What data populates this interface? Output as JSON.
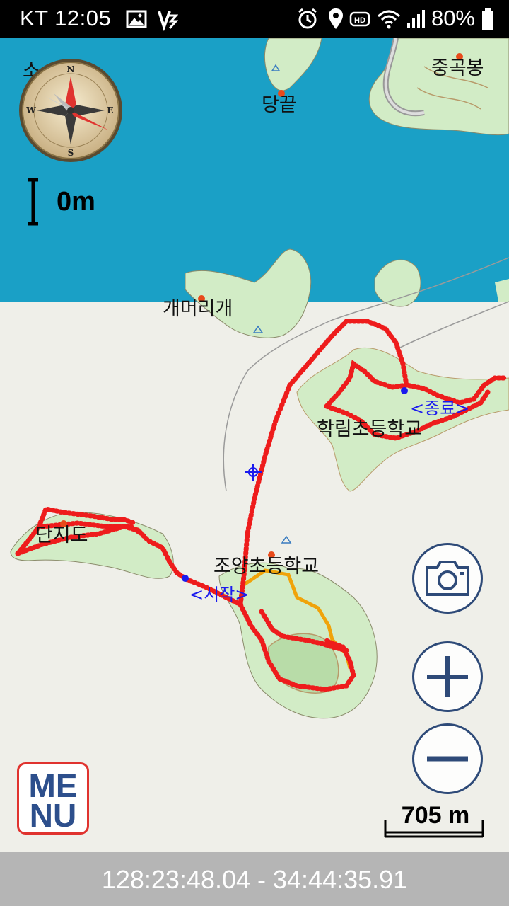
{
  "status_bar": {
    "carrier_time": "KT 12:05",
    "battery": "80%",
    "left_icons": [
      "gallery-icon",
      "v3-app-icon"
    ],
    "right_icons": [
      "alarm-icon",
      "location-icon",
      "hd-icon",
      "wifi-icon",
      "signal-icon",
      "battery-icon"
    ]
  },
  "map": {
    "places": {
      "dangkkeut": "당끝",
      "junggokbong": "중곡봉",
      "gaemeorigae": "개머리개",
      "hakrim_school": "학림초등학교",
      "danjido": "단지도",
      "joyang_school": "조양초등학교",
      "top_left_partial": "소"
    },
    "waypoints": {
      "start": "<시작>",
      "end": "<종료>"
    },
    "colors": {
      "sea": "#1aa0c6",
      "land": "#efefe9",
      "forest": "#d2ecc6",
      "track": "#ee1c1c",
      "route": "#f0a30a",
      "waypoint": "#1a1aee"
    }
  },
  "distance": {
    "label": "0m"
  },
  "buttons": {
    "menu_line1": "ME",
    "menu_line2": "NU"
  },
  "scale": {
    "label": "705 m"
  },
  "coordinates": {
    "text": "128:23:48.04 - 34:44:35.91"
  }
}
